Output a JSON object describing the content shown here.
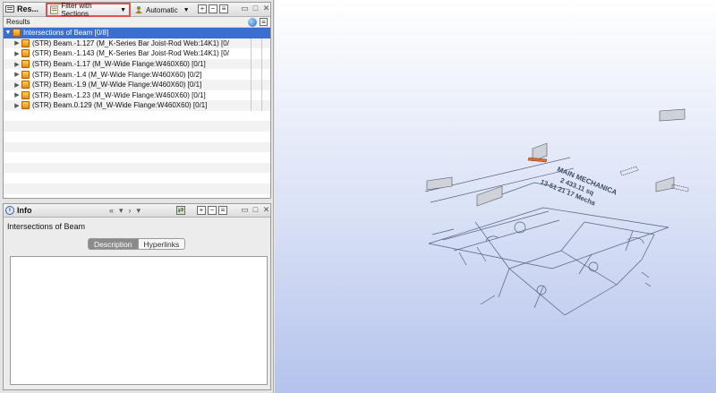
{
  "results_panel": {
    "title": "Res...",
    "filter_label": "Filter with Sections",
    "automatic_label": "Automatic",
    "results_header": "Results",
    "rows": [
      {
        "label": "Intersections of Beam [0/8]",
        "selected": true,
        "expanded": true
      },
      {
        "label": "(STR) Beam.-1.127 (M_K-Series Bar Joist-Rod Web:14K1) [0/"
      },
      {
        "label": "(STR) Beam.-1.143 (M_K-Series Bar Joist-Rod Web:14K1) [0/"
      },
      {
        "label": "(STR) Beam.-1.17 (M_W-Wide Flange:W460X60) [0/1]"
      },
      {
        "label": "(STR) Beam.-1.4 (M_W-Wide Flange:W460X60) [0/2]"
      },
      {
        "label": "(STR) Beam.-1.9 (M_W-Wide Flange:W460X60) [0/1]"
      },
      {
        "label": "(STR) Beam.-1.23 (M_W-Wide Flange:W460X60) [0/1]"
      },
      {
        "label": "(STR) Beam.0.129 (M_W-Wide Flange:W460X60) [0/1]"
      }
    ]
  },
  "info_panel": {
    "title": "Info",
    "subject": "Intersections of Beam",
    "tabs": [
      {
        "label": "Description",
        "active": true
      },
      {
        "label": "Hyperlinks",
        "active": false
      }
    ]
  },
  "view": {
    "plan_text": [
      "MAIN MECHANICA",
      "2 433.11 sq",
      "13-51 21 17 Mecha"
    ]
  },
  "colors": {
    "selection": "#3a6fcf",
    "filter_highlight": "#e0524a",
    "clash_beam": "#e06a2b"
  },
  "icons": [
    "results-icon",
    "filter-icon",
    "automatic-icon",
    "expand-all-icon",
    "collapse-all-icon",
    "list-icon",
    "minimize-icon",
    "maximize-icon",
    "close-icon",
    "globe-icon",
    "info-icon",
    "back-icon",
    "forward-icon"
  ]
}
